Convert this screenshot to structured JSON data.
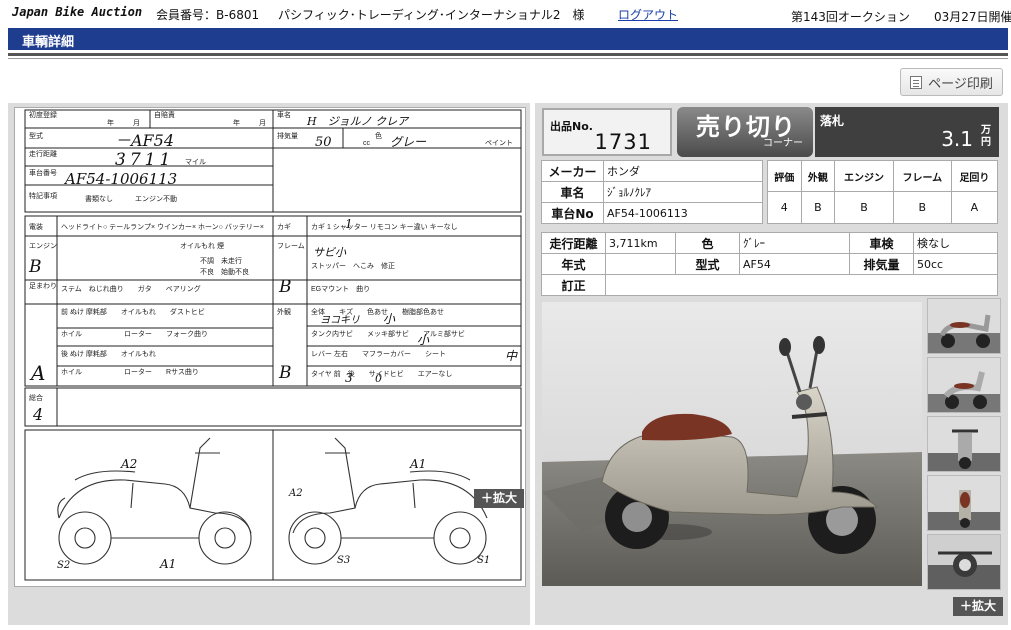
{
  "header": {
    "brand": "Japan Bike Auction",
    "member_label": "会員番号：B-6801",
    "company": "パシフィック･トレーディング･インターナショナル2　様",
    "logout": "ログアウト",
    "auction": "第143回オークション",
    "date": "03月27日開催"
  },
  "page_title": "車輌詳細",
  "print_button": "ページ印刷",
  "zoom_label": "＋拡大",
  "lot": {
    "label": "出品No.",
    "number": "1731"
  },
  "sold": {
    "title": "売り切り",
    "sub": "コーナー"
  },
  "bid": {
    "label": "落札",
    "value": "3.1",
    "unit_top": "万",
    "unit_bottom": "円"
  },
  "basic": {
    "rows": [
      {
        "label": "メーカー",
        "value": "ホンダ"
      },
      {
        "label": "車名",
        "value": "ｼﾞｮﾙﾉｸﾚｱ"
      },
      {
        "label": "車台No",
        "value": "AF54-1006113"
      }
    ]
  },
  "grades": {
    "headers": [
      "評価",
      "外観",
      "エンジン",
      "フレーム",
      "足回り"
    ],
    "values": [
      "4",
      "B",
      "B",
      "B",
      "A"
    ]
  },
  "detail": {
    "mileage_label": "走行距離",
    "mileage": "3,711km",
    "color_label": "色",
    "color": "ｸﾞﾚｰ",
    "inspection_label": "車検",
    "inspection": "検なし",
    "year_label": "年式",
    "year": "",
    "model_label": "型式",
    "model": "AF54",
    "displacement_label": "排気量",
    "displacement": "50cc",
    "correction_label": "訂正",
    "correction": ""
  },
  "sheet": {
    "hw_name": "H　ジョルノ クレア",
    "hw_model": "－AF54",
    "hw_mileage": "3711",
    "hw_frame": "AF54-1006113",
    "hw_cc": "50",
    "hw_color": "グレー",
    "hw_engine_grade": "B",
    "hw_leg_grade": "A",
    "hw_ext_grade": "B",
    "hw_frame_grade": "B",
    "hw_total": "4",
    "hw_a2_left": "A2",
    "hw_a1_left": "A1",
    "hw_s2": "S2",
    "hw_a1_right": "A1",
    "hw_a2_right": "A2",
    "hw_s1": "S1",
    "hw_s3": "S3",
    "hw_key": "1",
    "hw_wear1": "小",
    "hw_wear2": "中",
    "hw_tire": "3",
    "hw_seat": "左右",
    "hw_scratch": "ヨコキリ",
    "hw_frame_note": "サビ小",
    "hw_tire_sub": "0",
    "lbl_first_reg": "初度登録",
    "lbl_year": "年",
    "lbl_month": "月",
    "lbl_liability": "自賠責",
    "lbl_car_name": "車名",
    "lbl_type": "型式",
    "lbl_displacement": "排気量",
    "lbl_cc": "cc",
    "lbl_color": "色",
    "lbl_paint": "ペイント",
    "lbl_mileage": "走行距離",
    "lbl_mile": "マイル",
    "lbl_frame_no": "車台番号",
    "lbl_notes": "特記事項",
    "lbl_docs": "書類なし",
    "lbl_no_engine": "エンジン不動",
    "lbl_electric": "電装",
    "lbl_elec_items": "ヘッドライト○ テールランプ×  ウインカー×  ホーン○  バッテリー×",
    "lbl_key": "カギ",
    "lbl_key_items": "カギ 1  シャッター   リモコン   キー違い  キーなし",
    "lbl_engine": "エンジン",
    "lbl_engine_items": "オイルもれ   煙",
    "lbl_engine_items2": "不調　未走行",
    "lbl_engine_items3": "不良　始動不良",
    "lbl_frame": "フレーム",
    "lbl_frame_items": "ストッパー　へこみ　修正",
    "lbl_eg_mount": "EGマウント　曲り",
    "lbl_suspension": "足まわり",
    "lbl_susp_items": "ステム　ねじれ曲り　　ガタ　　ベアリング",
    "lbl_susp_f": "前 ぬけ 摩耗部　　オイルもれ　　ダストヒビ",
    "lbl_wheel": "ホイル　　　　　　ローター　　フォーク曲り",
    "lbl_susp_r": "後 ぬけ 摩耗部　　オイルもれ",
    "lbl_wheel2": "ホイル　　　　　　ローター　　Rサス曲り",
    "lbl_exterior": "外観",
    "lbl_ext1": "全体　　キズ　　色あせ　　樹脂部色あせ",
    "lbl_ext2": "タンク内サビ　　メッキ部サビ　　アルミ部サビ",
    "lbl_ext3": "レバー 左右　　マフラーカバー　　シート",
    "lbl_ext4": "タイヤ 前　後　　サイドヒビ　　エアーなし",
    "lbl_total": "総合"
  }
}
